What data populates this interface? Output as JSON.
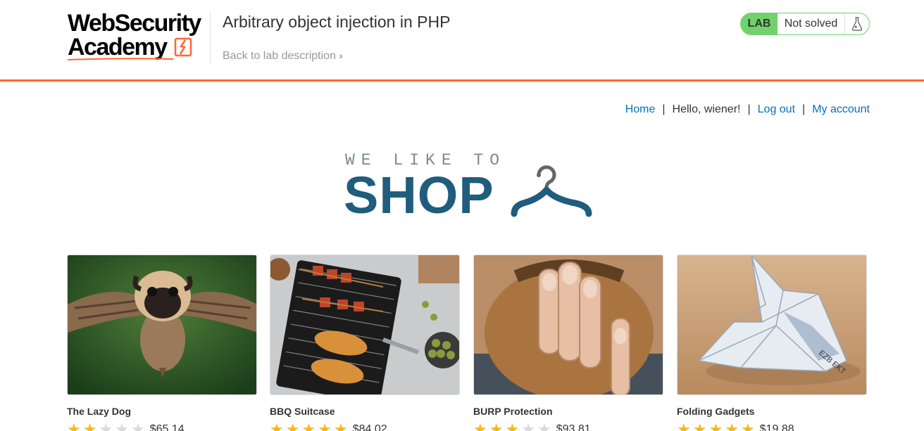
{
  "header": {
    "logo_line1": "WebSecurity",
    "logo_line2": "Academy",
    "lab_title": "Arbitrary object injection in PHP",
    "back_link": "Back to lab description",
    "status_label": "LAB",
    "status_text": "Not solved",
    "accent_color": "#ff6633",
    "status_color": "#70d16d"
  },
  "nav": {
    "home": "Home",
    "separator": "|",
    "greeting": "Hello, wiener!",
    "logout": "Log out",
    "account": "My account"
  },
  "banner": {
    "tagline": "WE LIKE TO",
    "word": "SHOP",
    "icon": "hanger-icon"
  },
  "products": [
    {
      "name": "The Lazy Dog",
      "rating": 2,
      "price": "$65.14"
    },
    {
      "name": "BBQ Suitcase",
      "rating": 5,
      "price": "$84.02"
    },
    {
      "name": "BURP Protection",
      "rating": 3,
      "price": "$93.81"
    },
    {
      "name": "Folding Gadgets",
      "rating": 5,
      "price": "$19.88"
    }
  ]
}
